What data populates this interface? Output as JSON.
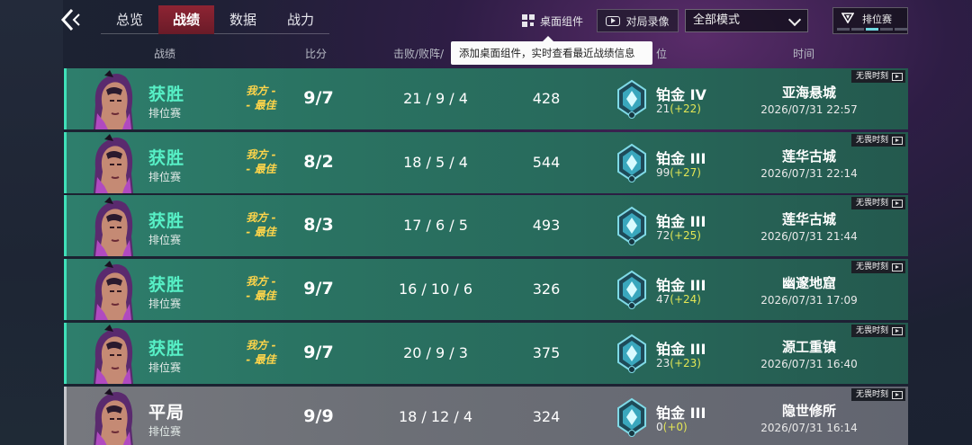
{
  "nav": {
    "tabs": [
      {
        "label": "总览"
      },
      {
        "label": "战绩",
        "active": true
      },
      {
        "label": "数据"
      },
      {
        "label": "战力"
      }
    ]
  },
  "toolbar": {
    "widget_label": "桌面组件",
    "replay_label": "对局录像",
    "mode_select_value": "全部模式",
    "rank_badge_label": "排位赛"
  },
  "tooltip": "添加桌面组件，实时查看最近战绩信息",
  "columns": {
    "record": "战绩",
    "score": "比分",
    "kda_partial": "击败/败阵/",
    "tier_partial": "位",
    "time": "时间"
  },
  "colors": {
    "win_text": "#57f0c6",
    "win_row": "#2a7362",
    "draw_row": "#6c6f76",
    "mvp_text": "#ffd54a",
    "tier_gain": "#e3e655",
    "active_tab": "#8e2433"
  },
  "matches": [
    {
      "result": "获胜",
      "mode": "排位赛",
      "mvp_line1": "我方 -",
      "mvp_line2": "- 最佳",
      "score": "9/7",
      "kda": "21 / 9 / 4",
      "points": "428",
      "tier": "铂金 IV",
      "tier_points": "21",
      "tier_change": "(+22)",
      "map": "亚海悬城",
      "time": "2026/07/31 22:57",
      "tag": "无畏时刻",
      "status": "win"
    },
    {
      "result": "获胜",
      "mode": "排位赛",
      "mvp_line1": "我方 -",
      "mvp_line2": "- 最佳",
      "score": "8/2",
      "kda": "18 / 5 / 4",
      "points": "544",
      "tier": "铂金 III",
      "tier_points": "99",
      "tier_change": "(+27)",
      "map": "莲华古城",
      "time": "2026/07/31 22:14",
      "tag": "无畏时刻",
      "status": "win"
    },
    {
      "result": "获胜",
      "mode": "排位赛",
      "mvp_line1": "我方 -",
      "mvp_line2": "- 最佳",
      "score": "8/3",
      "kda": "17 / 6 / 5",
      "points": "493",
      "tier": "铂金 III",
      "tier_points": "72",
      "tier_change": "(+25)",
      "map": "莲华古城",
      "time": "2026/07/31 21:44",
      "tag": "无畏时刻",
      "status": "win"
    },
    {
      "result": "获胜",
      "mode": "排位赛",
      "mvp_line1": "我方 -",
      "mvp_line2": "- 最佳",
      "score": "9/7",
      "kda": "16 / 10 / 6",
      "points": "326",
      "tier": "铂金 III",
      "tier_points": "47",
      "tier_change": "(+24)",
      "map": "幽邃地窟",
      "time": "2026/07/31 17:09",
      "tag": "无畏时刻",
      "status": "win"
    },
    {
      "result": "获胜",
      "mode": "排位赛",
      "mvp_line1": "我方 -",
      "mvp_line2": "- 最佳",
      "score": "9/7",
      "kda": "20 / 9 / 3",
      "points": "375",
      "tier": "铂金 III",
      "tier_points": "23",
      "tier_change": "(+23)",
      "map": "源工重镇",
      "time": "2026/07/31 16:40",
      "tag": "无畏时刻",
      "status": "win"
    },
    {
      "result": "平局",
      "mode": "排位赛",
      "mvp_line1": "",
      "mvp_line2": "",
      "score": "9/9",
      "kda": "18 / 12 / 4",
      "points": "324",
      "tier": "铂金 III",
      "tier_points": "0",
      "tier_change": "(+0)",
      "map": "隐世修所",
      "time": "2026/07/31 16:14",
      "tag": "无畏时刻",
      "status": "draw"
    }
  ]
}
